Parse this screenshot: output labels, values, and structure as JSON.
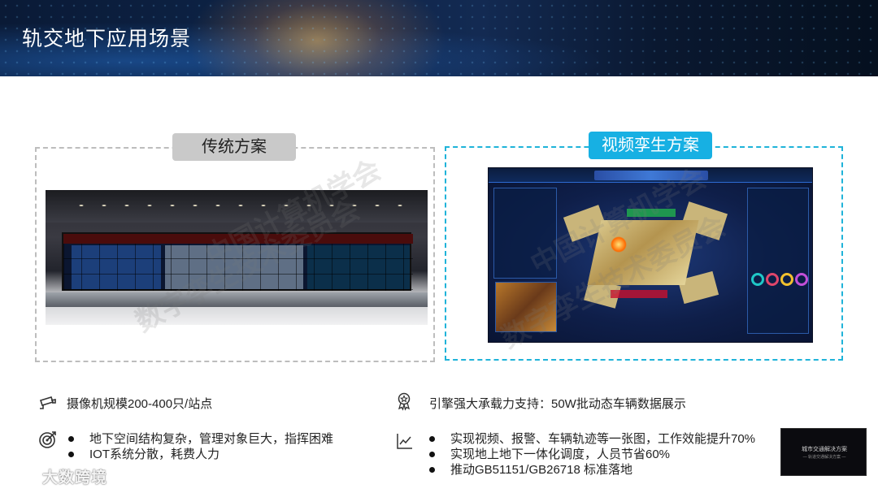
{
  "header": {
    "title": "轨交地下应用场景"
  },
  "traditional": {
    "tag": "传统方案",
    "image_alt": "control-room",
    "bullets_heading": "摄像机规模200-400只/站点",
    "bullets": [
      "地下空间结构复杂，管理对象巨大，指挥困难",
      "IOT系统分散，耗费人力"
    ]
  },
  "twin": {
    "tag": "视频孪生方案",
    "bullets_heading": "引擎强大承载力支持：50W批动态车辆数据展示",
    "bullets": [
      "实现视频、报警、车辆轨迹等一张图，工作效能提升70%",
      "实现地上地下一体化调度，人员节省60%",
      "推动GB51151/GB26718 标准落地"
    ]
  },
  "watermark": {
    "text_a": "中国计算机学会",
    "text_b": "数字孪生技术委员会"
  },
  "thumbnail": {
    "title": "城市交通解决方案",
    "subtitle": "— 轨道交通解决方案 —"
  },
  "logo": {
    "text": "大数跨境"
  },
  "colors": {
    "accent": "#17b0e3",
    "gray_tag": "#c9c9c9",
    "header_bg": "#0d2346"
  },
  "icons": {
    "camera": "cctv-camera-icon",
    "target": "target-icon",
    "badge": "award-badge-icon",
    "chart": "trend-chart-icon"
  }
}
